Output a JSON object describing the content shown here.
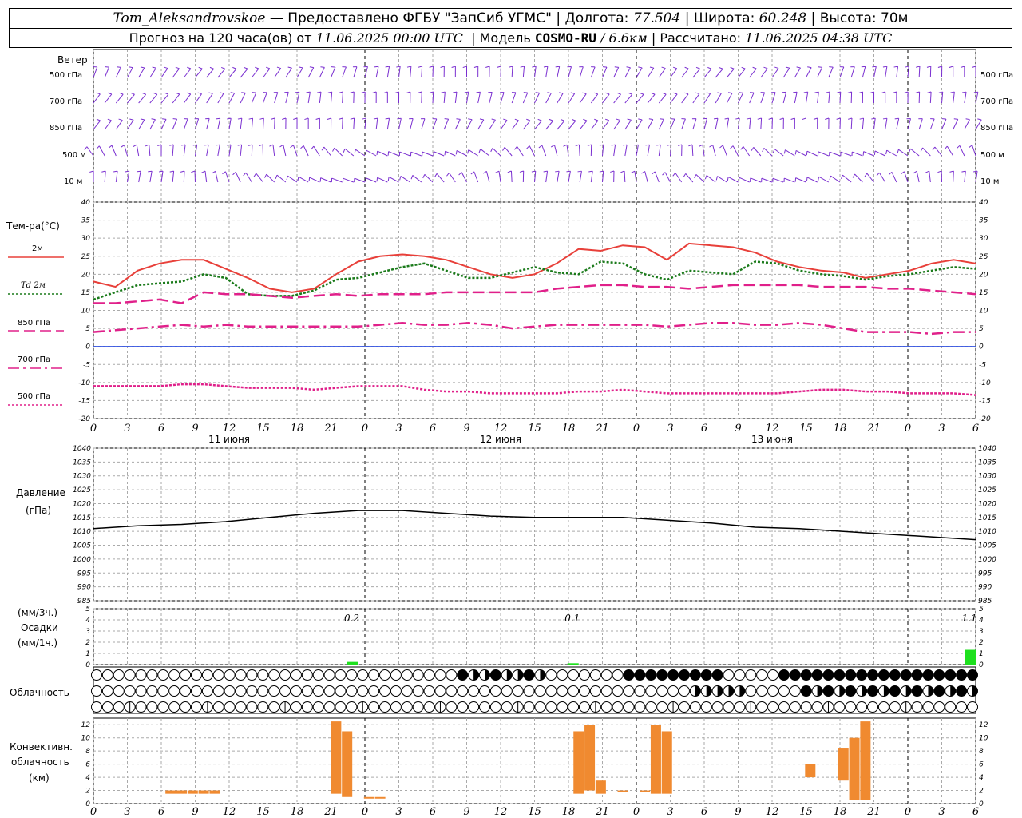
{
  "header": {
    "station": "Tom_Aleksandrovskoe",
    "provider": "— Предоставлено ФГБУ \"ЗапСиб УГМС\"",
    "lon_label": "Долгота:",
    "lon_value": "77.504",
    "lat_label": "Широта:",
    "lat_value": "60.248",
    "alt_label": "Высота:",
    "alt_value": "70м",
    "forecast_label": "Прогноз на 120 часа(ов) от",
    "forecast_start": "11.06.2025 00:00 UTC",
    "model_label": "Модель",
    "model_name": "COSMO-RU",
    "model_res": "/ 6.6км",
    "calc_label": "Рассчитано:",
    "calc_time": "11.06.2025 04:38 UTC"
  },
  "wind_panel": {
    "title": "Ветер",
    "levels": [
      "500 гПа",
      "700 гПа",
      "850 гПа",
      "500 м",
      "10  м"
    ],
    "barb_color": "#7a2fd0"
  },
  "temp_panel": {
    "title": "Тем-ра(°C)",
    "legend": [
      {
        "label": "2м",
        "color": "#e8403a",
        "style": "solid"
      },
      {
        "label": "Td  2м",
        "color": "#1a7a1a",
        "style": "dotted"
      },
      {
        "label": "850 гПа",
        "color": "#e0208a",
        "style": "dashed"
      },
      {
        "label": "700 гПа",
        "color": "#e0208a",
        "style": "dashdot"
      },
      {
        "label": "500 гПа",
        "color": "#e0208a",
        "style": "dotted"
      }
    ]
  },
  "pressure_panel": {
    "title": "Давление",
    "unit": "(гПа)"
  },
  "precip_panel": {
    "unit1": "(мм/3ч.)",
    "title": "Осадки",
    "unit2": "(мм/1ч.)",
    "amounts": [
      "0.2",
      "0.1",
      "1.1"
    ],
    "bar_color": "#1ee01e"
  },
  "cloud_panel": {
    "title": "Облачность"
  },
  "conv_panel": {
    "title1": "Конвективн.",
    "title2": "облачность",
    "unit": "(км)",
    "bar_color": "#f08a30"
  },
  "time_axis": {
    "ticks": [
      "0",
      "3",
      "6",
      "9",
      "12",
      "15",
      "18",
      "21",
      "0",
      "3",
      "6",
      "9",
      "12",
      "15",
      "18",
      "21",
      "0",
      "3",
      "6",
      "9",
      "12",
      "15",
      "18",
      "21",
      "0",
      "3",
      "6"
    ],
    "days": [
      "11 июня",
      "12 июня",
      "13 июня"
    ]
  },
  "chart_data": [
    {
      "type": "line",
      "title": "Тем-ра(°C)",
      "ylim": [
        -20,
        40
      ],
      "yticks": [
        40,
        35,
        30,
        25,
        20,
        15,
        10,
        5,
        0,
        -5,
        -10,
        -15,
        -20
      ],
      "x_hours": [
        0,
        3,
        6,
        9,
        12,
        15,
        18,
        21,
        24,
        27,
        30,
        33,
        36,
        39,
        42,
        45,
        48,
        51,
        54,
        57,
        60,
        63,
        66,
        69,
        72,
        75,
        78
      ],
      "series": [
        {
          "name": "2м",
          "values": [
            18,
            16.5,
            21,
            23,
            24,
            24,
            21.5,
            19,
            16,
            15,
            16,
            20,
            23.5,
            25,
            25.5,
            25,
            24,
            22,
            20,
            19,
            20,
            23,
            27,
            26.5,
            28,
            27.5,
            24
          ]
        },
        {
          "name": "Td  2м",
          "values": [
            13,
            15,
            17,
            17.5,
            18,
            20,
            19,
            14.5,
            14,
            14,
            15.5,
            18.5,
            19,
            20.5,
            22,
            23,
            21,
            19,
            19,
            20.5,
            22,
            20.5,
            20,
            23.5,
            23,
            20,
            18.5
          ]
        },
        {
          "name": "850 гПа",
          "values": [
            12,
            12,
            12.5,
            13,
            12,
            15,
            14.5,
            14.5,
            14,
            13.5,
            14,
            14.5,
            14,
            14.5,
            14.5,
            14.5,
            15,
            15,
            15,
            15,
            15,
            16,
            16.5,
            17,
            17,
            16.5,
            16.5
          ]
        },
        {
          "name": "700 гПа",
          "values": [
            4,
            4.5,
            5,
            5.5,
            6,
            5.5,
            6,
            5.5,
            5.5,
            5.5,
            5.5,
            5.5,
            5.5,
            6,
            6.5,
            6,
            6,
            6.5,
            6,
            5,
            5.5,
            6,
            6,
            6,
            6,
            6,
            5.5
          ]
        },
        {
          "name": "500 гПа",
          "values": [
            -11,
            -11,
            -11,
            -11,
            -10.5,
            -10.5,
            -11,
            -11.5,
            -11.5,
            -11.5,
            -12,
            -11.5,
            -11,
            -11,
            -11,
            -12,
            -12.5,
            -12.5,
            -13,
            -13,
            -13,
            -13,
            -12.5,
            -12.5,
            -12,
            -12.5,
            -13
          ]
        }
      ],
      "extra_x_hours": [
        81,
        84,
        87,
        90,
        93,
        96,
        99,
        102,
        105,
        108,
        111,
        114,
        117,
        120
      ],
      "extra_values": {
        "2м": [
          28.5,
          28,
          27.5,
          26,
          23.5,
          22,
          21,
          20.5,
          19,
          20,
          21,
          23,
          24,
          23
        ],
        "Td  2м": [
          21,
          20.5,
          20,
          23.5,
          23,
          21,
          20,
          19.5,
          18.5,
          19.5,
          20,
          21,
          22,
          21.5
        ],
        "850 гПа": [
          16,
          16.5,
          17,
          17,
          17,
          17,
          16.5,
          16.5,
          16.5,
          16,
          16,
          15.5,
          15,
          14.5
        ],
        "700 гПа": [
          6,
          6.5,
          6.5,
          6,
          6,
          6.5,
          6,
          5,
          4,
          4,
          4,
          3.5,
          4,
          4
        ],
        "500 гПа": [
          -13,
          -13,
          -13,
          -13,
          -13,
          -12.5,
          -12,
          -12,
          -12.5,
          -12.5,
          -13,
          -13,
          -13,
          -13.5
        ]
      }
    },
    {
      "type": "line",
      "title": "Давление",
      "ylim": [
        985,
        1040
      ],
      "yticks": [
        1040,
        1035,
        1030,
        1025,
        1020,
        1015,
        1010,
        1005,
        1000,
        995,
        990,
        985
      ],
      "x_hours": [
        0,
        6,
        12,
        18,
        24,
        30,
        36,
        42,
        48,
        54,
        60,
        66,
        72,
        78,
        84,
        90,
        96,
        102,
        108,
        114,
        120
      ],
      "series": [
        {
          "name": "",
          "values": [
            1011,
            1012,
            1012.5,
            1013.5,
            1015,
            1016.5,
            1017.5,
            1017.5,
            1016.5,
            1015.5,
            1015,
            1015,
            1015,
            1014,
            1013,
            1011.5,
            1011,
            1010,
            1009,
            1008,
            1007
          ]
        }
      ]
    },
    {
      "type": "bar",
      "title": "Осадки",
      "ylim": [
        0,
        5
      ],
      "bars": [
        {
          "x_hour": 36,
          "value": 0.2
        },
        {
          "x_hour": 66,
          "value": 0.1
        },
        {
          "x_hour": 120,
          "value": 1.1
        }
      ]
    },
    {
      "type": "bar",
      "title": "Конвективн. облачность",
      "ylim": [
        0,
        13
      ],
      "yticks": [
        12,
        10,
        8,
        6,
        4,
        2,
        0
      ],
      "bars": [
        {
          "x_hour": 10.5,
          "base": 1.5,
          "top": 2
        },
        {
          "x_hour": 12,
          "base": 1.5,
          "top": 2
        },
        {
          "x_hour": 13.5,
          "base": 1.5,
          "top": 2
        },
        {
          "x_hour": 15,
          "base": 1.5,
          "top": 2
        },
        {
          "x_hour": 16.5,
          "base": 1.5,
          "top": 2
        },
        {
          "x_hour": 33,
          "base": 1.5,
          "top": 12.5
        },
        {
          "x_hour": 34.5,
          "base": 1,
          "top": 11
        },
        {
          "x_hour": 37.5,
          "base": 0.8,
          "top": 1
        },
        {
          "x_hour": 39,
          "base": 0.8,
          "top": 1
        },
        {
          "x_hour": 66,
          "base": 1.5,
          "top": 11
        },
        {
          "x_hour": 67.5,
          "base": 2,
          "top": 12
        },
        {
          "x_hour": 69,
          "base": 1.5,
          "top": 3.5
        },
        {
          "x_hour": 72,
          "base": 1.8,
          "top": 2
        },
        {
          "x_hour": 75,
          "base": 1.8,
          "top": 2
        },
        {
          "x_hour": 76.5,
          "base": 1.5,
          "top": 12
        },
        {
          "x_hour": 78,
          "base": 1.5,
          "top": 11
        },
        {
          "x_hour": 97.5,
          "base": 4,
          "top": 6
        },
        {
          "x_hour": 102,
          "base": 3.5,
          "top": 8.5
        },
        {
          "x_hour": 103.5,
          "base": 0.5,
          "top": 10
        },
        {
          "x_hour": 105,
          "base": 0.5,
          "top": 12.5
        }
      ]
    }
  ]
}
